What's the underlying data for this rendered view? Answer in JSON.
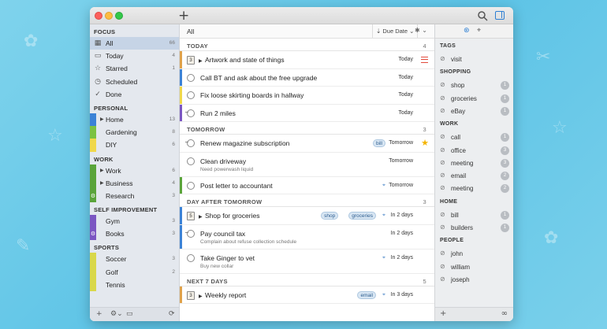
{
  "sidebar": {
    "sections": [
      {
        "title": "FOCUS",
        "items": [
          {
            "label": "All",
            "count": "66",
            "icon": "grid-icon",
            "selected": true
          },
          {
            "label": "Today",
            "count": "4",
            "icon": "calendar-icon"
          },
          {
            "label": "Starred",
            "count": "1",
            "icon": "star-icon"
          },
          {
            "label": "Scheduled",
            "count": "",
            "icon": "clock-icon"
          },
          {
            "label": "Done",
            "count": "",
            "icon": "check-icon"
          }
        ]
      },
      {
        "title": "PERSONAL",
        "items": [
          {
            "label": "Home",
            "count": "13",
            "color": "#3b82d6",
            "expand": true
          },
          {
            "label": "Gardening",
            "count": "8",
            "color": "#7cc242"
          },
          {
            "label": "DIY",
            "count": "6",
            "color": "#f0d84a"
          }
        ]
      },
      {
        "title": "WORK",
        "items": [
          {
            "label": "Work",
            "count": "6",
            "color": "#5aa43a",
            "expand": true
          },
          {
            "label": "Business",
            "count": "4",
            "color": "#5aa43a",
            "expand": true
          },
          {
            "label": "Research",
            "count": "3",
            "color": "#5aa43a",
            "gear": true
          }
        ]
      },
      {
        "title": "SELF IMPROVEMENT",
        "items": [
          {
            "label": "Gym",
            "count": "3",
            "color": "#7b56c2"
          },
          {
            "label": "Books",
            "count": "3",
            "color": "#7b56c2",
            "gear": true
          }
        ]
      },
      {
        "title": "SPORTS",
        "items": [
          {
            "label": "Soccer",
            "count": "3",
            "color": "#d9d84a"
          },
          {
            "label": "Golf",
            "count": "2",
            "color": "#d9d84a"
          },
          {
            "label": "Tennis",
            "count": "",
            "color": "#d9d84a"
          }
        ]
      }
    ]
  },
  "toolbar": {
    "filter_label": "All",
    "sort_label": "Due Date"
  },
  "groups": [
    {
      "title": "TODAY",
      "count": "4",
      "tasks": [
        {
          "title": "Artwork and state of things",
          "due": "Today",
          "bar": "#e0a24a",
          "kind": "project",
          "project_num": "3",
          "flag": "lines"
        },
        {
          "title": "Call BT and ask about the free upgrade",
          "due": "Today",
          "bar": "#3b82d6"
        },
        {
          "title": "Fix loose skirting boards in hallway",
          "due": "Today",
          "bar": "#f0d84a"
        },
        {
          "title": "Run 2 miles",
          "due": "Today",
          "bar": "#7b56c2",
          "repeat": true
        }
      ]
    },
    {
      "title": "TOMORROW",
      "count": "3",
      "tasks": [
        {
          "title": "Renew magazine subscription",
          "due": "Tomorrow",
          "tags": [
            "bill"
          ],
          "flag": "star",
          "repeat": true
        },
        {
          "title": "Clean driveway",
          "note": "Need powerwash liquid",
          "due": "Tomorrow"
        },
        {
          "title": "Post letter to accountant",
          "due": "Tomorrow",
          "bar": "#5aa43a",
          "location": true
        }
      ]
    },
    {
      "title": "DAY AFTER TOMORROW",
      "count": "3",
      "tasks": [
        {
          "title": "Shop for groceries",
          "due": "In 2 days",
          "bar": "#3b82d6",
          "kind": "project",
          "project_num": "5",
          "tags": [
            "shop",
            "groceries"
          ],
          "location": true
        },
        {
          "title": "Pay council tax",
          "note": "Complain about refuse collection schedule",
          "due": "In 2 days",
          "bar": "#3b82d6",
          "repeat": true
        },
        {
          "title": "Take Ginger to vet",
          "note": "Buy new collar",
          "due": "In 2 days",
          "location": true
        }
      ]
    },
    {
      "title": "NEXT 7 DAYS",
      "count": "5",
      "tasks": [
        {
          "title": "Weekly report",
          "due": "In 3 days",
          "bar": "#e0a24a",
          "kind": "project",
          "project_num": "3",
          "tags": [
            "email"
          ],
          "location": true
        }
      ]
    }
  ],
  "tags_panel": {
    "sections": [
      {
        "title": "TAGS",
        "items": [
          {
            "label": "visit",
            "count": ""
          }
        ]
      },
      {
        "title": "SHOPPING",
        "items": [
          {
            "label": "shop",
            "count": "1"
          },
          {
            "label": "groceries",
            "count": "1"
          },
          {
            "label": "eBay",
            "count": "1"
          }
        ]
      },
      {
        "title": "WORK",
        "items": [
          {
            "label": "call",
            "count": "1"
          },
          {
            "label": "office",
            "count": "3"
          },
          {
            "label": "meeting",
            "count": "3"
          },
          {
            "label": "email",
            "count": "2"
          },
          {
            "label": "meeting",
            "count": "2"
          }
        ]
      },
      {
        "title": "HOME",
        "items": [
          {
            "label": "bill",
            "count": "1"
          },
          {
            "label": "builders",
            "count": "1"
          }
        ]
      },
      {
        "title": "PEOPLE",
        "items": [
          {
            "label": "john",
            "count": ""
          },
          {
            "label": "william",
            "count": ""
          },
          {
            "label": "joseph",
            "count": ""
          }
        ]
      }
    ]
  }
}
